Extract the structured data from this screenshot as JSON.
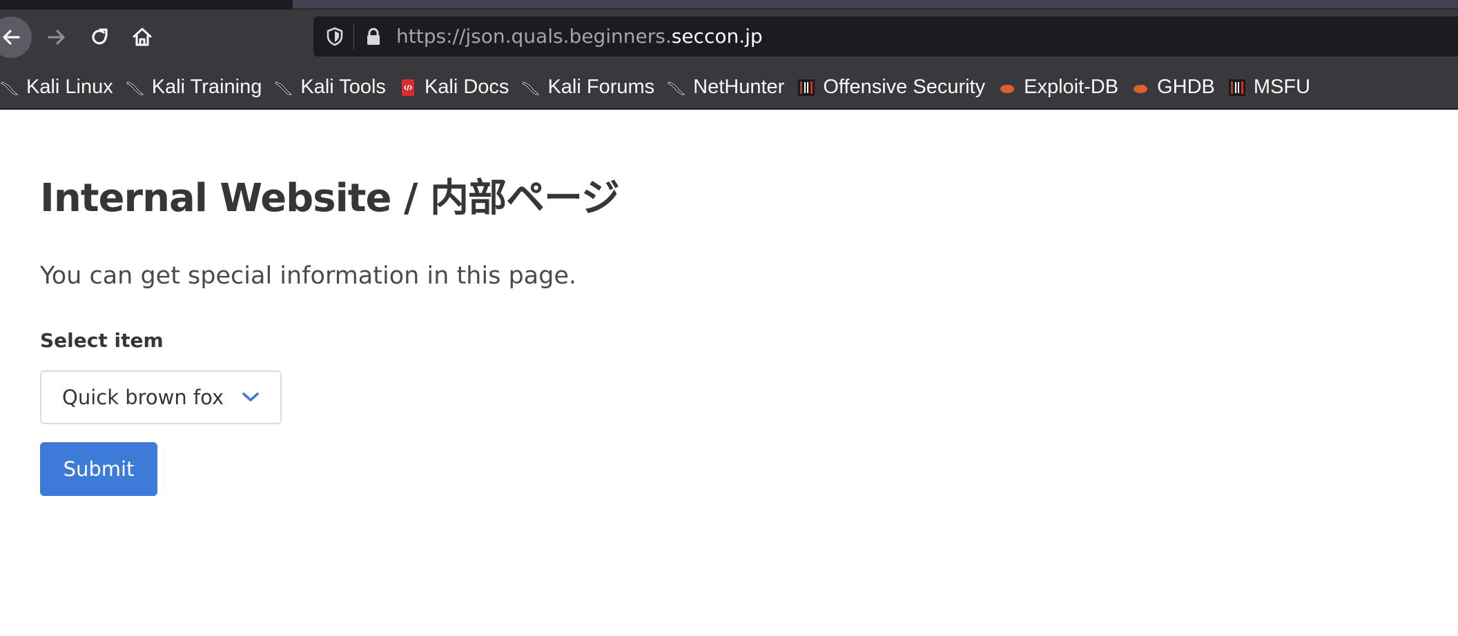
{
  "browser": {
    "url_prefix": "https://json.quals.beginners.",
    "url_host": "seccon.jp",
    "more_label": "•••",
    "toolbar": {
      "back_icon": "arrow-left-icon",
      "forward_icon": "arrow-right-icon",
      "reload_icon": "reload-icon",
      "home_icon": "home-icon"
    }
  },
  "bookmarks": [
    {
      "label": "Kali Linux",
      "icon": "kali-dragon-icon"
    },
    {
      "label": "Kali Training",
      "icon": "kali-dragon-icon"
    },
    {
      "label": "Kali Tools",
      "icon": "kali-dragon-icon"
    },
    {
      "label": "Kali Docs",
      "icon": "kali-docs-icon"
    },
    {
      "label": "Kali Forums",
      "icon": "kali-dragon-icon"
    },
    {
      "label": "NetHunter",
      "icon": "kali-dragon-icon"
    },
    {
      "label": "Offensive Security",
      "icon": "offsec-icon"
    },
    {
      "label": "Exploit-DB",
      "icon": "exploitdb-icon"
    },
    {
      "label": "GHDB",
      "icon": "exploitdb-icon"
    },
    {
      "label": "MSFU",
      "icon": "offsec-icon"
    }
  ],
  "page": {
    "title": "Internal Website / 内部ページ",
    "subtitle": "You can get special information in this page.",
    "select_label": "Select item",
    "select_value": "Quick brown fox",
    "submit_label": "Submit"
  },
  "colors": {
    "chrome_bg": "#38383d",
    "urlbar_bg": "#1c1b22",
    "accent_button": "#3e7ad8",
    "chevron": "#3e7ad8",
    "text_dark": "#363636"
  }
}
